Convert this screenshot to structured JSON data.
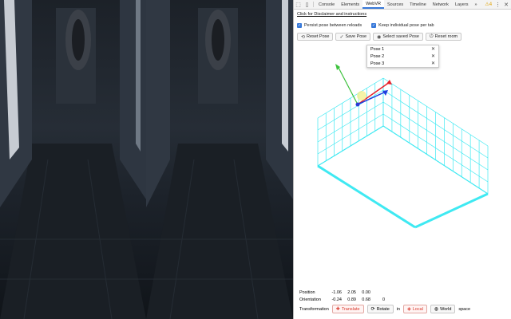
{
  "toolbar": {
    "tabs": [
      {
        "label": "Console",
        "active": false
      },
      {
        "label": "Elements",
        "active": false
      },
      {
        "label": "WebVR",
        "active": true
      },
      {
        "label": "Sources",
        "active": false
      },
      {
        "label": "Timeline",
        "active": false
      },
      {
        "label": "Network",
        "active": false
      },
      {
        "label": "Layers",
        "active": false
      }
    ],
    "more_tabs": "»",
    "warning_count": "4",
    "warning_icon": "⚠",
    "inspect_icon": "inspect-icon",
    "device_icon": "device-icon"
  },
  "disclaimer_link": "Click for Disclaimer and instructions",
  "options": {
    "persist_label": "Persist pose between reloads",
    "keep_label": "Keep individual pose per tab",
    "persist_checked": true,
    "keep_checked": true
  },
  "buttons": {
    "reset_pose": "Reset Pose",
    "save_pose": "Save Pose",
    "select_saved": "Select saved Pose",
    "reset_room": "Reset room"
  },
  "saved_poses": [
    "Pose 1",
    "Pose 2",
    "Pose 3"
  ],
  "readout": {
    "position_label": "Position",
    "position": [
      "-1.06",
      "2.05",
      "0.00"
    ],
    "orientation_label": "Orientation",
    "orientation": [
      "-0.24",
      "0.89",
      "0.68",
      "0"
    ]
  },
  "transform": {
    "label": "Transformation",
    "translate": "Translate",
    "rotate": "Rotate",
    "in_label": "in",
    "local": "Local",
    "world": "World",
    "space_label": "space"
  },
  "colors": {
    "accent": "#3879d9",
    "room_grid": "#3fe9f2",
    "axis_x": "#e8202a",
    "axis_y": "#3dc23d",
    "axis_z": "#1f3ee0",
    "active_red": "#d9362a"
  }
}
